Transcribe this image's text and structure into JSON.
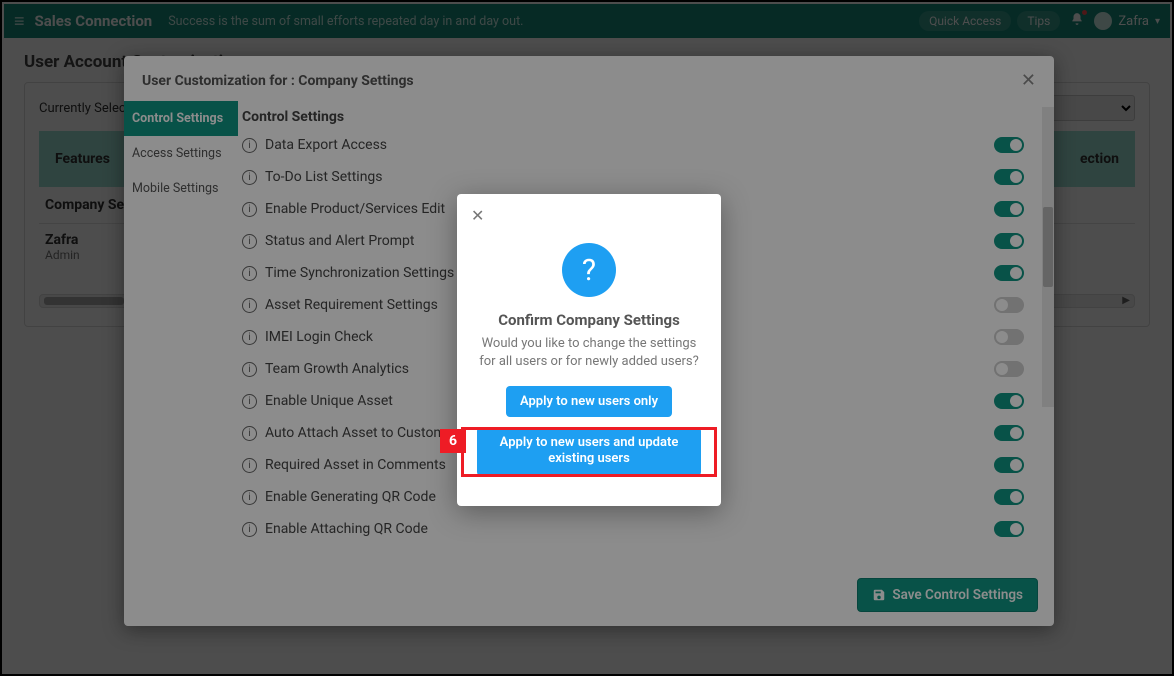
{
  "topbar": {
    "brand": "Sales Connection",
    "motto": "Success is the sum of small efforts repeated day in and day out.",
    "quick_access": "Quick Access",
    "tips": "Tips",
    "username": "Zafra"
  },
  "page": {
    "title": "User Account Customisation",
    "selected_label": "Currently Selected:",
    "feature_header_left": "Features",
    "feature_header_right": "ection",
    "row_company": "Company Settings",
    "user_name": "Zafra",
    "user_role": "Admin"
  },
  "modal1": {
    "title": "User Customization for : Company Settings",
    "side_tabs": [
      "Control Settings",
      "Access Settings",
      "Mobile Settings"
    ],
    "section_heading": "Control Settings",
    "settings": [
      {
        "label": "Data Export Access",
        "on": true
      },
      {
        "label": "To-Do List Settings",
        "on": true
      },
      {
        "label": "Enable Product/Services Edit",
        "on": true
      },
      {
        "label": "Status and Alert Prompt",
        "on": true
      },
      {
        "label": "Time Synchronization Settings",
        "on": true
      },
      {
        "label": "Asset Requirement Settings",
        "on": false
      },
      {
        "label": "IMEI Login Check",
        "on": false
      },
      {
        "label": "Team Growth Analytics",
        "on": false
      },
      {
        "label": "Enable Unique Asset",
        "on": true
      },
      {
        "label": "Auto Attach Asset to Customer & Project",
        "on": true
      },
      {
        "label": "Required Asset in Comments",
        "on": true
      },
      {
        "label": "Enable Generating QR Code",
        "on": true
      },
      {
        "label": "Enable Attaching QR Code",
        "on": true
      }
    ],
    "save_label": "Save Control Settings"
  },
  "confirm": {
    "title": "Confirm Company Settings",
    "text": "Would you like to change the settings for all users or for newly added users?",
    "btn_new_only": "Apply to new users only",
    "btn_all": "Apply to new users and update existing users"
  },
  "annotation": {
    "step": "6"
  }
}
